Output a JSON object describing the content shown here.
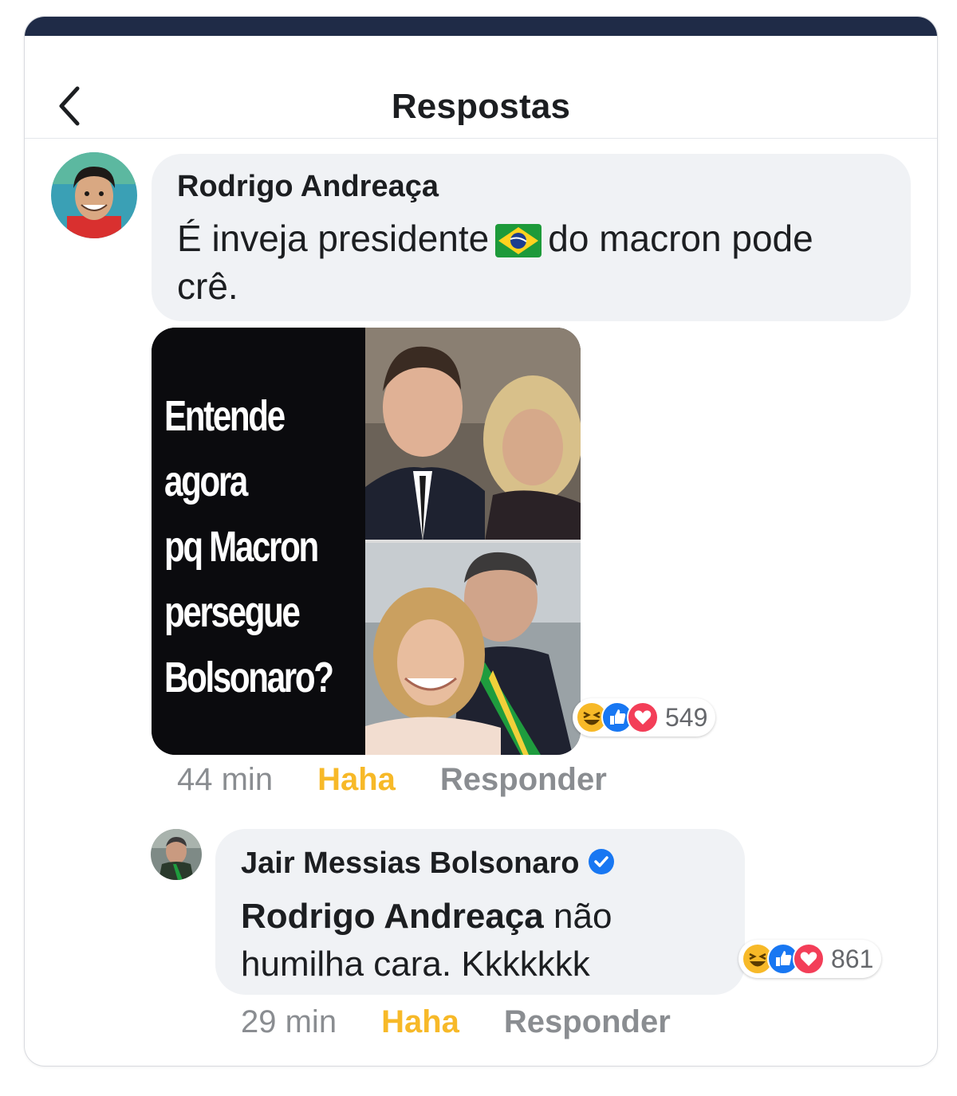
{
  "header": {
    "title": "Respostas",
    "back_icon": "chevron-left-icon"
  },
  "comment1": {
    "author": "Rodrigo Andreaça",
    "text_before": "É inveja presidente",
    "flag_icon": "brazil-flag-icon",
    "text_after": "do macron pode",
    "text_line2": "crê.",
    "image_text": [
      "Entende",
      "agora",
      "pq Macron",
      "persegue",
      "Bolsonaro?"
    ],
    "reactions": {
      "icons": [
        "haha",
        "like",
        "love"
      ],
      "count": "549"
    },
    "time": "44 min",
    "reaction_label": "Haha",
    "reply_label": "Responder"
  },
  "comment2": {
    "author": "Jair Messias Bolsonaro",
    "verified_icon": "verified-badge-icon",
    "mention": "Rodrigo Andreaça",
    "text_after_mention": "não",
    "text_line2": "humilha cara. Kkkkkkk",
    "reactions": {
      "icons": [
        "haha",
        "like",
        "love"
      ],
      "count": "861"
    },
    "time": "29 min",
    "reaction_label": "Haha",
    "reply_label": "Responder"
  },
  "colors": {
    "topbar": "#1f2b47",
    "bubble": "#f0f2f5",
    "haha": "#f7b928",
    "like": "#1877f2",
    "love": "#f33e58",
    "verified": "#1877f2",
    "muted": "#8a8d91"
  }
}
